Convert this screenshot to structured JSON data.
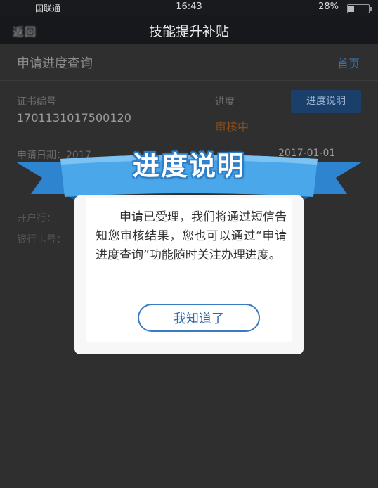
{
  "status": {
    "carrier": "国联通",
    "time": "16:43",
    "battery": "28%"
  },
  "nav": {
    "back": "返回",
    "title": "技能提升补贴"
  },
  "header": {
    "title": "申请进度查询",
    "home": "首页"
  },
  "info": {
    "cert_label": "证书编号",
    "cert_value": "1701131017500120",
    "progress_label": "进度",
    "progress_value": "审核中",
    "explain_button": "进度说明",
    "apply_label": "申请日期：2017",
    "apply_date": "2017-01-01",
    "bank_label": "开户行：",
    "card_label": "银行卡号："
  },
  "dialog": {
    "ribbon_title": "进度说明",
    "message": "申请已受理，我们将通过短信告知您审核结果，您也可以通过“申请进度查询”功能随时关注办理进度。",
    "ok_button": "我知道了"
  },
  "colors": {
    "ribbon": "#4aa8ea",
    "accent": "#2a6aad",
    "progress": "#8a4e17"
  }
}
